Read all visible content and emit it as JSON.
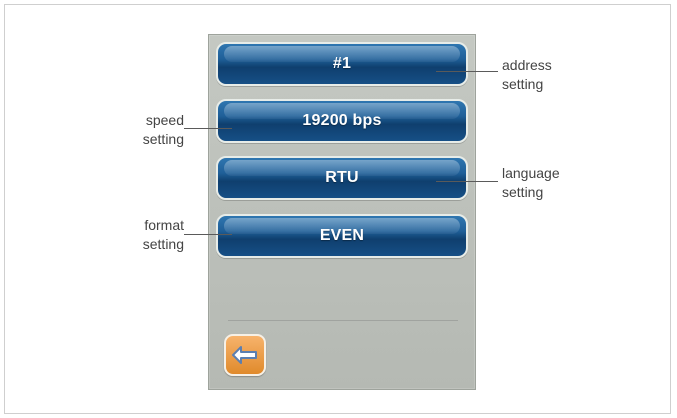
{
  "buttons": {
    "address_value": "#1",
    "speed_value": "19200 bps",
    "language_value": "RTU",
    "format_value": "EVEN"
  },
  "labels": {
    "address_line1": "address",
    "address_line2": "setting",
    "speed_line1": "speed",
    "speed_line2": "setting",
    "language_line1": "language",
    "language_line2": "setting",
    "format_line1": "format",
    "format_line2": "setting"
  },
  "icons": {
    "back": "back-arrow-icon"
  },
  "colors": {
    "button_blue": "#1f5f98",
    "back_orange": "#e08a2b",
    "panel_gray": "#b8bcb6"
  }
}
